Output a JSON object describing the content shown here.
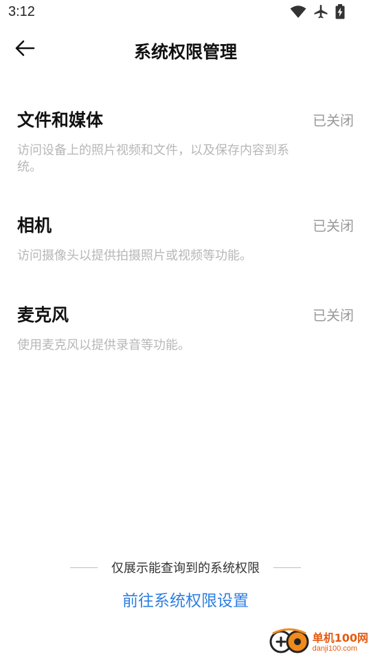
{
  "status_bar": {
    "time": "3:12",
    "icons": [
      "wifi-icon",
      "airplane-icon",
      "battery-charging-icon"
    ]
  },
  "header": {
    "title": "系统权限管理",
    "back_icon": "arrow-left-icon"
  },
  "permissions": [
    {
      "title": "文件和媒体",
      "status": "已关闭",
      "description": "访问设备上的照片视频和文件，以及保存内容到系统。"
    },
    {
      "title": "相机",
      "status": "已关闭",
      "description": "访问摄像头以提供拍摄照片或视频等功能。"
    },
    {
      "title": "麦克风",
      "status": "已关闭",
      "description": "使用麦克风以提供录音等功能。"
    }
  ],
  "footer": {
    "note": "仅展示能查询到的系统权限",
    "link": "前往系统权限设置"
  },
  "watermark": {
    "main": "单机100网",
    "sub": "danji100.com"
  },
  "colors": {
    "link": "#2f7fe0",
    "status": "#9a9a9a",
    "description": "#b7b7b7",
    "watermark": "#e35b12"
  }
}
